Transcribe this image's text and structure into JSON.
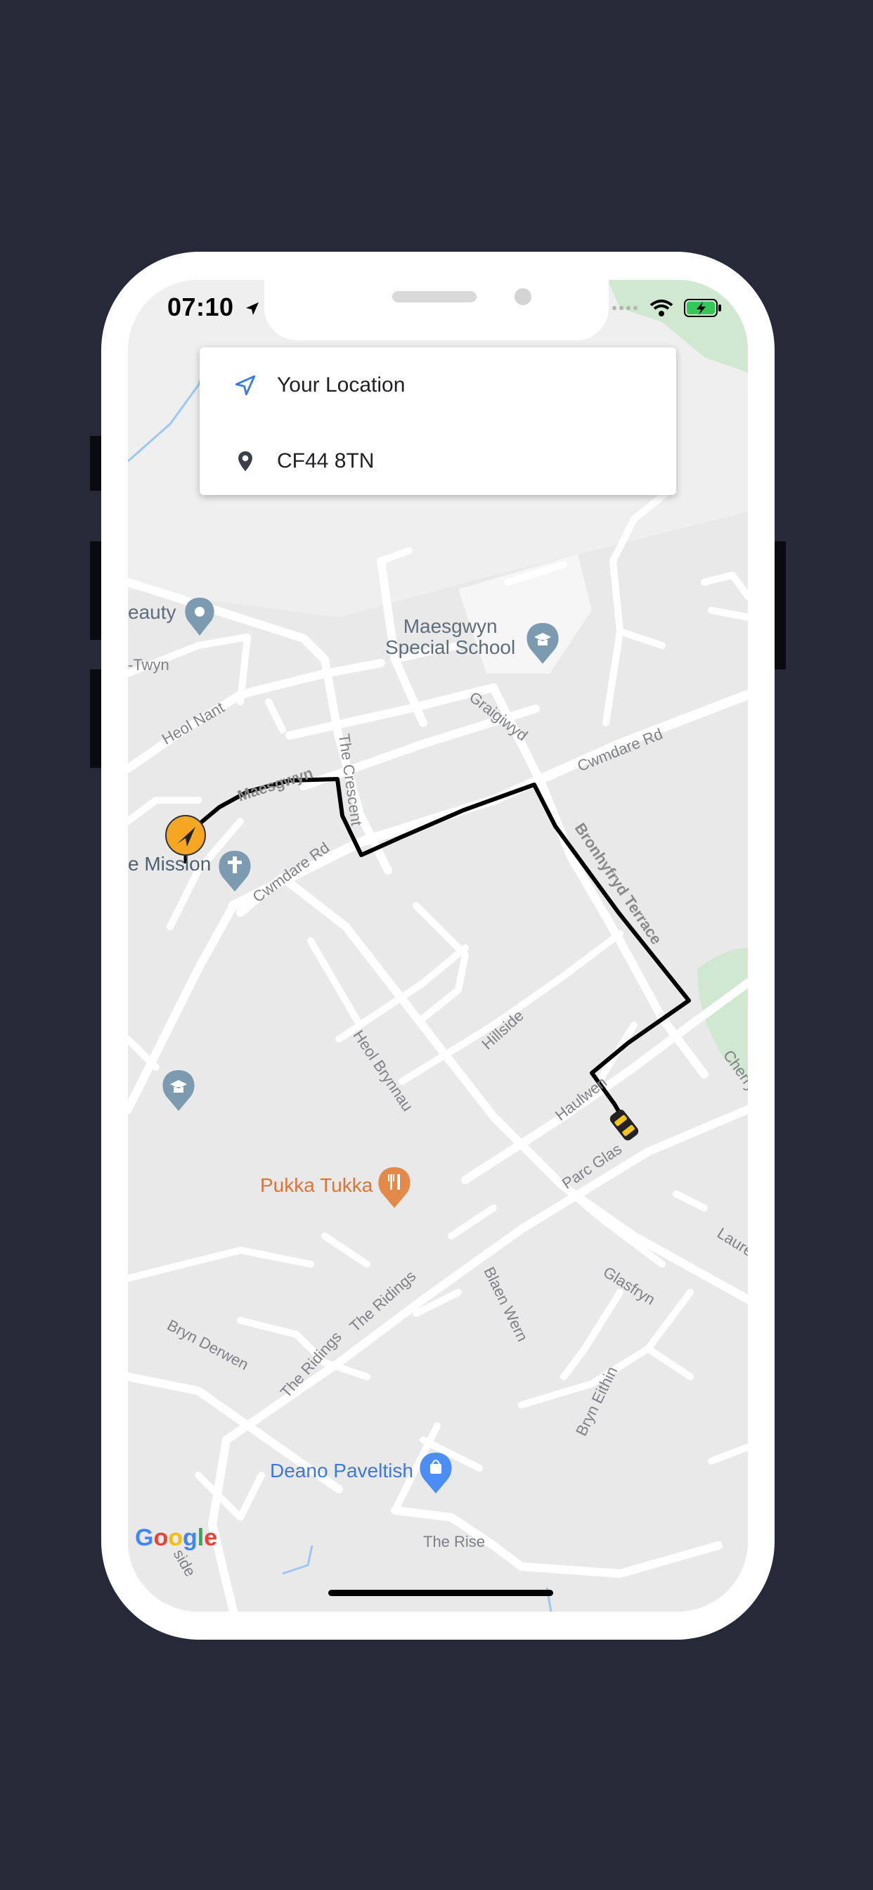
{
  "status_bar": {
    "time": "07:10"
  },
  "search": {
    "origin_label": "Your Location",
    "destination_label": "CF44 8TN"
  },
  "map": {
    "pois": {
      "school": "Maesgwyn\nSpecial School",
      "beauty": "eauty",
      "mission": "e Mission",
      "restaurant": "Pukka Tukka",
      "shop": "Deano Paveltish"
    },
    "streets": {
      "y_twyn": "-Twyn",
      "heol_nant": "Heol Nant",
      "maesgwyn": "Maesgwyn",
      "the_crescent": "The Crescent",
      "graigiwyd": "Graigiwyd",
      "cwmdare_rd_1": "Cwmdare Rd",
      "cwmdare_rd_2": "Cwmdare Rd",
      "bronhyfryd_terrace": "Bronhyfryd Terrace",
      "hillside": "Hillside",
      "heol_brynnau": "Heol Brynnau",
      "haulwen": "Haulwen",
      "cherry": "Cherry",
      "parc_glas": "Parc Glas",
      "laure": "Laure",
      "glasfryn": "Glasfryn",
      "blaen_wern": "Blaen Wern",
      "the_ridings_1": "The Ridings",
      "the_ridings_2": "The Ridings",
      "bryn_derwen": "Bryn Derwen",
      "bryn_eithin": "Bryn Eithin",
      "the_rise": "The Rise",
      "side": "side"
    },
    "logo": "Google"
  },
  "colors": {
    "background": "#262a38",
    "route": "#000000",
    "origin_marker": "#f5a623",
    "poi_blue": "#7c9bb0",
    "restaurant": "#e38a4a",
    "shop": "#4c8df6",
    "park": "#cfe8cf"
  }
}
